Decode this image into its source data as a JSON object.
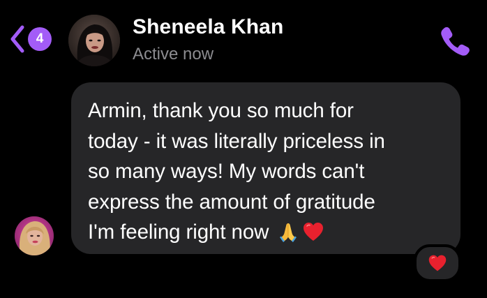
{
  "header": {
    "back_badge_count": "4",
    "contact_name": "Sheneela Khan",
    "contact_status": "Active now",
    "accent_color": "#a35cf7",
    "icons": {
      "back": "chevron-left-icon",
      "call": "phone-icon"
    }
  },
  "message": {
    "text": "Armin, thank you so much for\ntoday - it was literally priceless in\nso many ways! My words can't\nexpress the amount of gratitude\nI'm feeling right now",
    "trailing_emojis": [
      "folded-hands-emoji",
      "red-heart-emoji"
    ],
    "reaction": "red-heart-emoji"
  },
  "colors": {
    "background": "#000000",
    "bubble": "#262628",
    "status_text": "#8c8c90",
    "heart": "#e8212e"
  }
}
